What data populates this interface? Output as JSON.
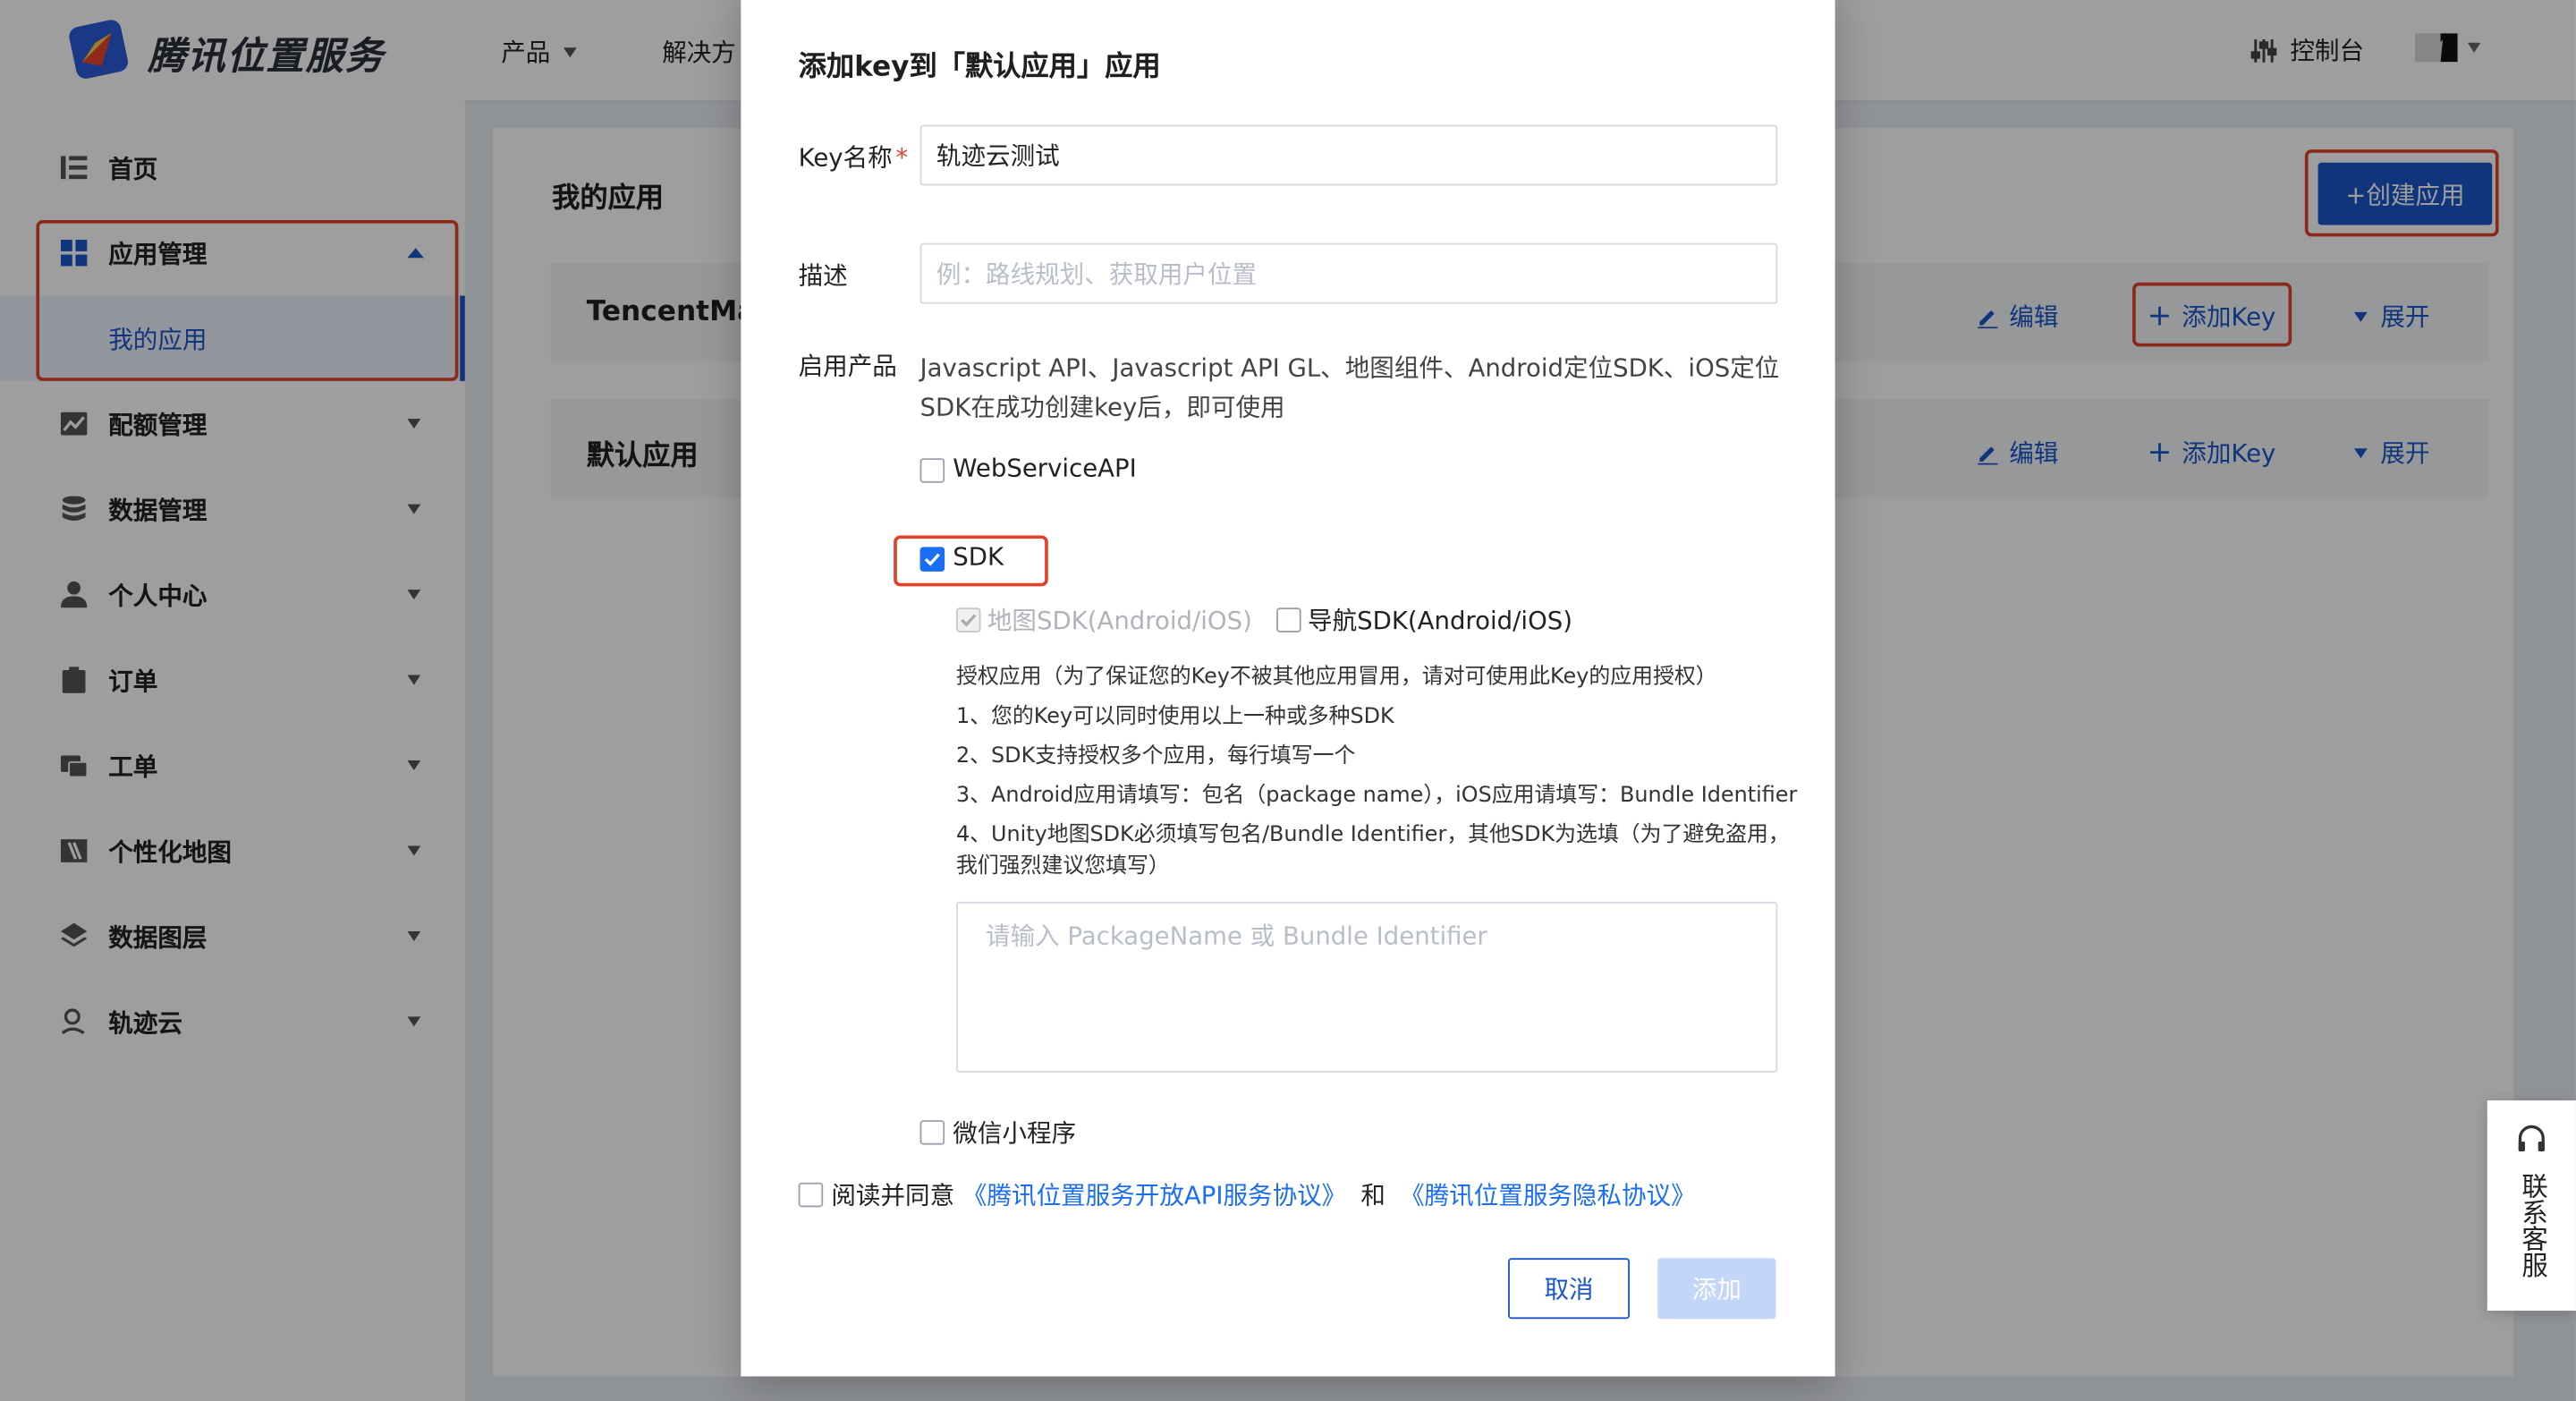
{
  "brand": {
    "name": "腾讯位置服务"
  },
  "topnav": {
    "items": [
      {
        "label": "产品"
      },
      {
        "label": "解决方"
      }
    ],
    "console": "控制台"
  },
  "sidebar": {
    "items": [
      {
        "label": "首页"
      },
      {
        "label": "应用管理",
        "sub": "我的应用"
      },
      {
        "label": "配额管理"
      },
      {
        "label": "数据管理"
      },
      {
        "label": "个人中心"
      },
      {
        "label": "订单"
      },
      {
        "label": "工单"
      },
      {
        "label": "个性化地图"
      },
      {
        "label": "数据图层"
      },
      {
        "label": "轨迹云"
      }
    ]
  },
  "page": {
    "title": "我的应用",
    "create_button": "+创建应用",
    "apps": [
      {
        "name": "TencentMa",
        "edit": "编辑",
        "add_key": "添加Key",
        "expand": "展开"
      },
      {
        "name": "默认应用",
        "edit": "编辑",
        "add_key": "添加Key",
        "expand": "展开"
      }
    ]
  },
  "modal": {
    "title": "添加key到「默认应用」应用",
    "key_name_label": "Key名称",
    "required_mark": "*",
    "key_name_value": "轨迹云测试",
    "desc_label": "描述",
    "desc_placeholder": "例：路线规划、获取用户位置",
    "product_label": "启用产品",
    "product_text_1": "Javascript API、Javascript API GL、地图组件、Android定位SDK、iOS定位",
    "product_text_2": "SDK在成功创建key后，即可使用",
    "webservice": "WebServiceAPI",
    "sdk": "SDK",
    "map_sdk": "地图SDK(Android/iOS)",
    "nav_sdk": "导航SDK(Android/iOS)",
    "auth_lines": [
      "授权应用（为了保证您的Key不被其他应用冒用，请对可使用此Key的应用授权）",
      "1、您的Key可以同时使用以上一种或多种SDK",
      "2、SDK支持授权多个应用，每行填写一个",
      "3、Android应用请填写：包名（package name），iOS应用请填写：Bundle Identifier",
      "4、Unity地图SDK必须填写包名/Bundle Identifier，其他SDK为选填（为了避免盗用，",
      "我们强烈建议您填写）"
    ],
    "package_placeholder": "请输入 PackageName 或 Bundle Identifier",
    "miniprogram": "微信小程序",
    "agree_prefix": "阅读并同意",
    "agreement_1": "《腾讯位置服务开放API服务协议》",
    "agree_and": "和",
    "agreement_2": "《腾讯位置服务隐私协议》",
    "cancel": "取消",
    "add": "添加"
  },
  "support": {
    "label": "联系客服"
  }
}
